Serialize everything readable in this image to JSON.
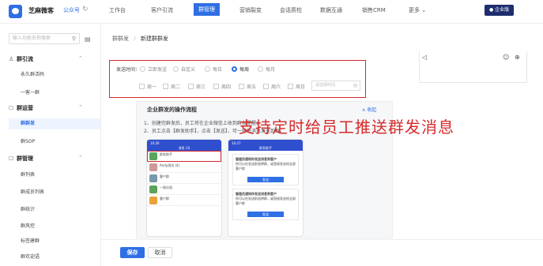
{
  "header": {
    "brand": "芝麻微客",
    "account_type": "公众号",
    "nav": [
      "工作台",
      "客户引流",
      "群管理",
      "营销裂变",
      "会话质检",
      "数据互通",
      "销售CRM",
      "更多 ⌄"
    ],
    "active_nav": "群管理",
    "enterprise_button": "企业版",
    "accent_color": "#2f6fe4"
  },
  "sidebar": {
    "search_placeholder": "输入功能名称搜索",
    "sections": [
      {
        "title": "群引流",
        "items": [
          "永久群活码",
          "一客一群"
        ]
      },
      {
        "title": "群运营",
        "items": [
          "群群发",
          "群SOP"
        ]
      },
      {
        "title": "群管理",
        "items": [
          "群列表",
          "群成员列表",
          "群统计",
          "群风控",
          "标签建群",
          "群欢迎语"
        ]
      }
    ],
    "active_item": "群群发"
  },
  "breadcrumb": {
    "parent": "群群发",
    "separator": "/",
    "current": "新建群群发"
  },
  "form": {
    "send_time_label": "发送时间：",
    "send_options": [
      "立即发送",
      "自定义",
      "每日",
      "每周",
      "每月"
    ],
    "selected_option": "每周",
    "weekdays": [
      "周一",
      "周二",
      "周三",
      "周四",
      "周五",
      "周六",
      "周日"
    ],
    "time_placeholder": "请选择时间"
  },
  "guide": {
    "title": "企业群发的操作流程",
    "collapse": "∧ 收起",
    "steps": [
      "1、创建完群发后，员工将在企业微信上收到群发提醒；",
      "2、员工点击【群发助手】，点击【发送】，可一键将消息发送到群。"
    ],
    "phone1": {
      "status_time": "10:26",
      "title": "消息 (3)",
      "rows": [
        "群发助手",
        "Andy测试 (4)",
        "客户群",
        "一周分组",
        "客户群"
      ]
    },
    "phone2": {
      "status_time": "10:27",
      "title": "群发助手",
      "card_title": "管理员通知你发送消息到客户",
      "card_body": "你可以在发送前选择群，或直接发送给全部客户群",
      "send_button": "发送"
    }
  },
  "overlay_text": "支持定时给员工推送群发消息",
  "footer": {
    "save": "保存",
    "cancel": "取消"
  }
}
